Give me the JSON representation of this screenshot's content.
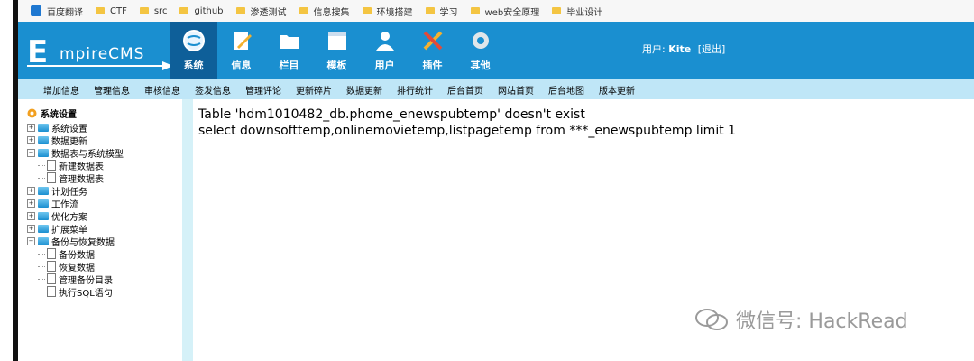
{
  "bookmarks": [
    {
      "label": "百度翻译",
      "icon": "translate-icon"
    },
    {
      "label": "CTF",
      "icon": "folder-icon"
    },
    {
      "label": "src",
      "icon": "folder-icon"
    },
    {
      "label": "github",
      "icon": "folder-icon"
    },
    {
      "label": "渗透测试",
      "icon": "folder-icon"
    },
    {
      "label": "信息搜集",
      "icon": "folder-icon"
    },
    {
      "label": "环境搭建",
      "icon": "folder-icon"
    },
    {
      "label": "学习",
      "icon": "folder-icon"
    },
    {
      "label": "web安全原理",
      "icon": "folder-icon"
    },
    {
      "label": "毕业设计",
      "icon": "folder-icon"
    }
  ],
  "header": {
    "logo_big": "E",
    "logo_rest": "mpireCMS",
    "nav": [
      {
        "label": "系统",
        "icon": "globe-icon",
        "active": true
      },
      {
        "label": "信息",
        "icon": "edit-icon"
      },
      {
        "label": "栏目",
        "icon": "folder-icon"
      },
      {
        "label": "模板",
        "icon": "window-icon"
      },
      {
        "label": "用户",
        "icon": "user-icon"
      },
      {
        "label": "插件",
        "icon": "tools-icon"
      },
      {
        "label": "其他",
        "icon": "gear-icon"
      }
    ],
    "user_prefix": "用户:",
    "user_name": "Kite",
    "logout": "[退出]"
  },
  "submenu": [
    "增加信息",
    "管理信息",
    "审核信息",
    "签发信息",
    "管理评论",
    "更新碎片",
    "数据更新",
    "排行统计",
    "后台首页",
    "网站首页",
    "后台地图",
    "版本更新"
  ],
  "sidebar": {
    "title": "系统设置",
    "tree": [
      {
        "type": "node",
        "label": "系统设置",
        "expanded": false
      },
      {
        "type": "node",
        "label": "数据更新",
        "expanded": false
      },
      {
        "type": "node",
        "label": "数据表与系统模型",
        "expanded": true
      },
      {
        "type": "leaf",
        "label": "新建数据表"
      },
      {
        "type": "leaf",
        "label": "管理数据表"
      },
      {
        "type": "node",
        "label": "计划任务",
        "expanded": false
      },
      {
        "type": "node",
        "label": "工作流",
        "expanded": false
      },
      {
        "type": "node",
        "label": "优化方案",
        "expanded": false
      },
      {
        "type": "node",
        "label": "扩展菜单",
        "expanded": false
      },
      {
        "type": "node",
        "label": "备份与恢复数据",
        "expanded": true
      },
      {
        "type": "leaf",
        "label": "备份数据"
      },
      {
        "type": "leaf",
        "label": "恢复数据"
      },
      {
        "type": "leaf",
        "label": "管理备份目录"
      },
      {
        "type": "leaf",
        "label": "执行SQL语句"
      }
    ]
  },
  "main": {
    "error_line1": "Table 'hdm1010482_db.phome_enewspubtemp' doesn't exist",
    "error_line2": "select downsofttemp,onlinemovietemp,listpagetemp from ***_enewspubtemp limit 1"
  },
  "watermark": "微信号: HackRead"
}
